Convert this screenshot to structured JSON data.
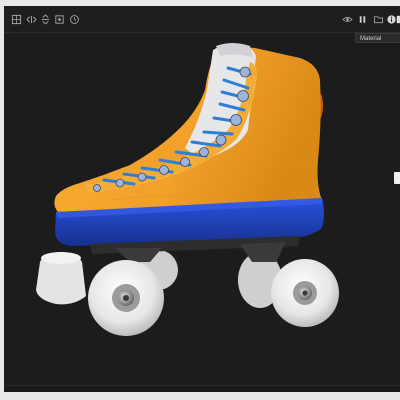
{
  "toolbar": {
    "left_icons": [
      {
        "icon": "grid-icon",
        "name": "grid-toggle"
      },
      {
        "icon": "split-horizontal-icon",
        "name": "split-view"
      },
      {
        "icon": "split-vertical-icon",
        "name": "vertical-split"
      },
      {
        "icon": "frame-icon",
        "name": "frame-view"
      },
      {
        "icon": "clock-icon",
        "name": "history"
      }
    ],
    "right_icons": [
      {
        "icon": "eye-icon",
        "name": "visibility-toggle"
      },
      {
        "icon": "pause-icon",
        "name": "pause-render"
      },
      {
        "icon": "folder-icon",
        "name": "open-folder"
      },
      {
        "icon": "info-icon",
        "name": "info"
      },
      {
        "icon": "panel-icon",
        "name": "panel-toggle"
      }
    ]
  },
  "material_dropdown": {
    "value": "Material"
  },
  "colors": {
    "boot_orange": "#f2a12a",
    "boot_orange_dark": "#d88614",
    "sole_blue": "#2243c8",
    "sole_blue_dark": "#17308f",
    "lace_blue": "#2d7fd6",
    "wheel_white": "#e9e9e9",
    "background": "#1c1c1c"
  }
}
